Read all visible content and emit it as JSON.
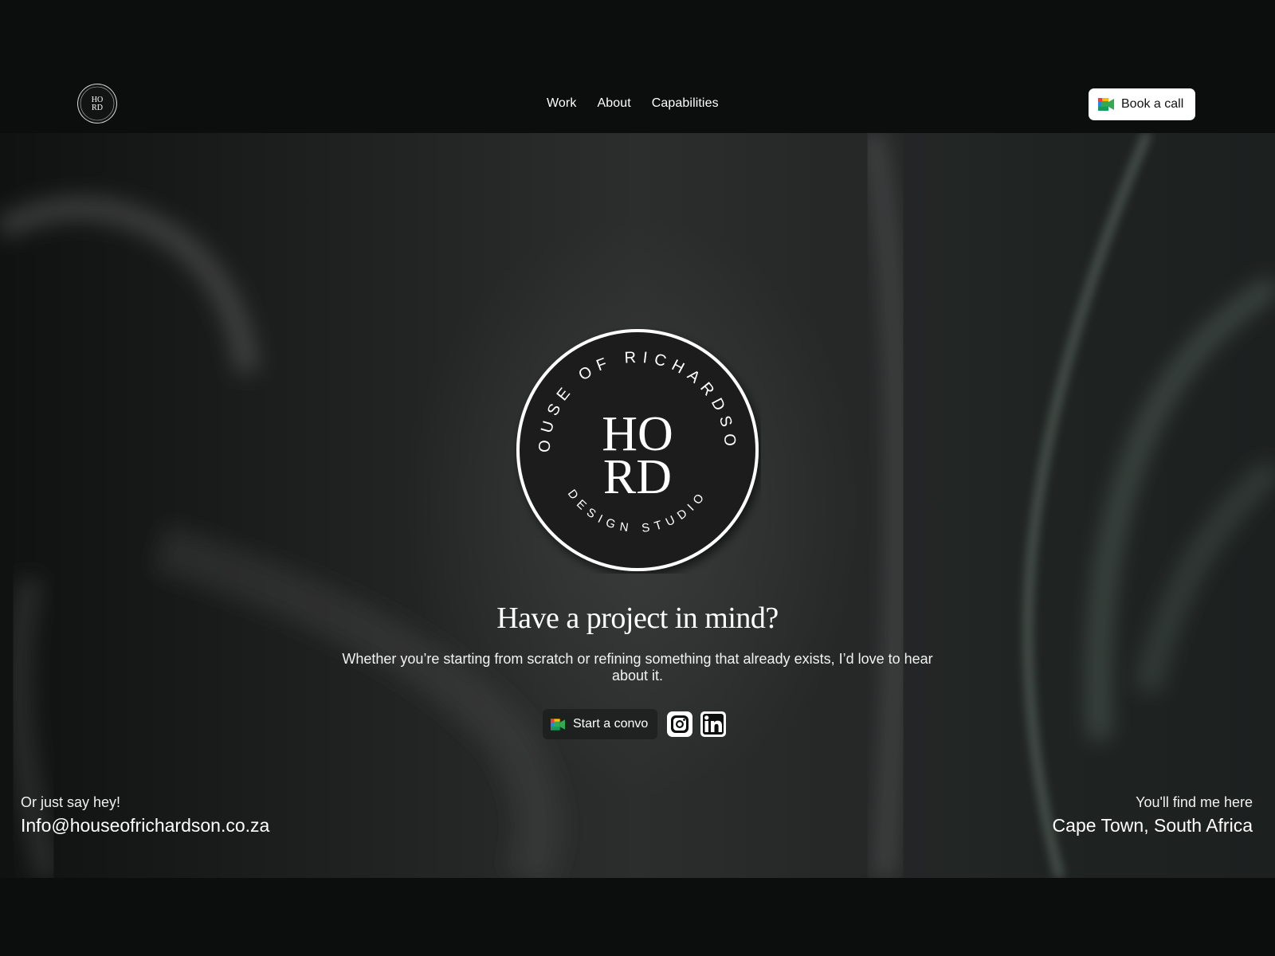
{
  "brand": {
    "logo_alt": "House of Richardson Design Studio",
    "monogram_top": "HO",
    "monogram_bottom": "RD",
    "ring_text_top": "HOUSE OF RICHARDSON",
    "ring_text_bottom": "DESIGN STUDIO",
    "logo_icon": "hord-monogram-icon"
  },
  "nav": {
    "items": [
      {
        "label": "Work"
      },
      {
        "label": "About"
      },
      {
        "label": "Capabilities"
      }
    ]
  },
  "header_cta": {
    "label": "Book a call",
    "icon": "google-meet-icon"
  },
  "hero": {
    "headline": "Have a project in mind?",
    "subtext": "Whether you’re starting from scratch or refining something that already exists, I’d love to hear about it.",
    "cta_label": "Start a convo",
    "cta_icon": "google-meet-icon",
    "socials": [
      {
        "name": "instagram-icon"
      },
      {
        "name": "linkedin-icon"
      }
    ]
  },
  "contact": {
    "left_kicker": "Or just say hey!",
    "email": "Info@houseofrichardson.co.za",
    "right_kicker": "You'll find me here",
    "location": "Cape Town, South Africa"
  },
  "colors": {
    "background": "#0c0d0d",
    "button_bg": "#ffffff",
    "text": "#ffffff"
  }
}
